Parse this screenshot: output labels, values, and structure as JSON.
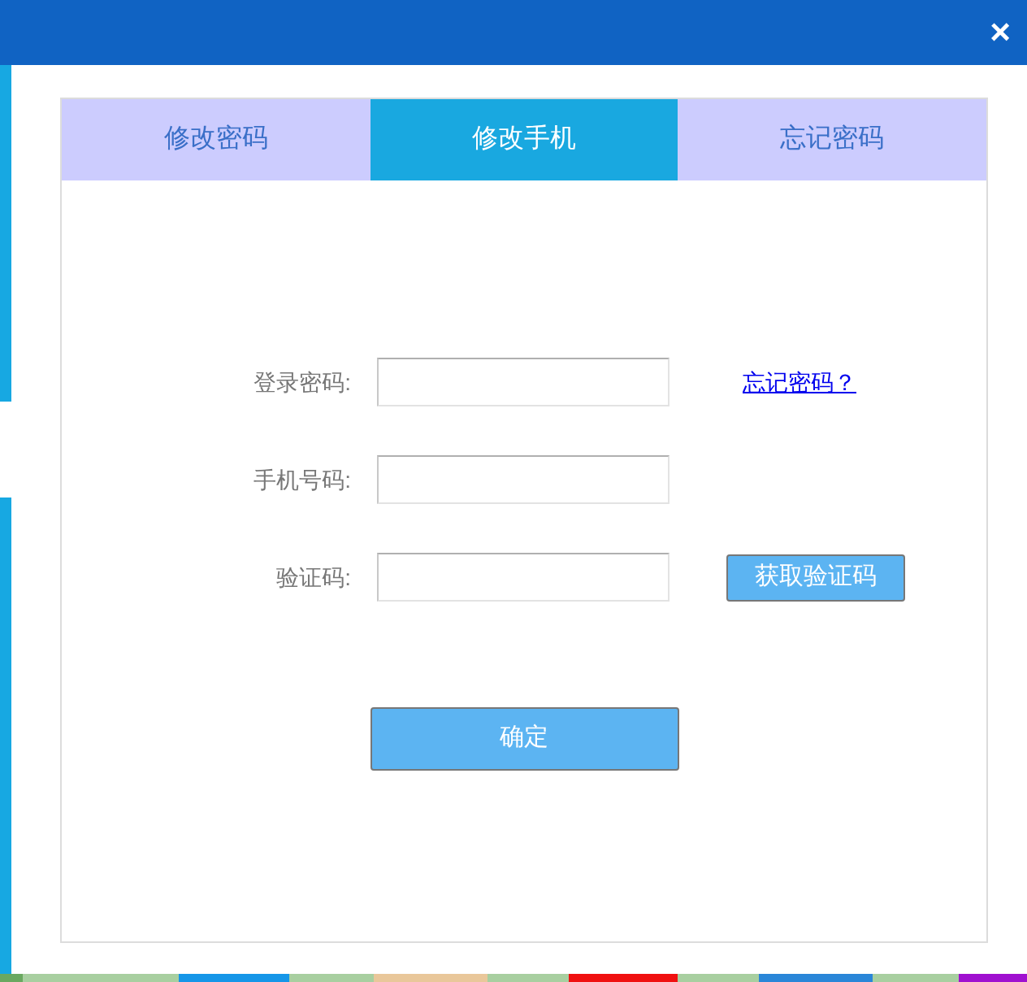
{
  "close_button": "×",
  "tabs": [
    {
      "label": "修改密码",
      "selected": false
    },
    {
      "label": "修改手机",
      "selected": true
    },
    {
      "label": "忘记密码",
      "selected": false
    }
  ],
  "form": [
    {
      "label": "登录密码:",
      "extra": {
        "kind": "link",
        "text": "忘记密码？"
      }
    },
    {
      "label": "手机号码:"
    },
    {
      "label": "验证码:",
      "extra": {
        "kind": "button",
        "text": "获取验证码"
      }
    }
  ],
  "submit": "确定"
}
